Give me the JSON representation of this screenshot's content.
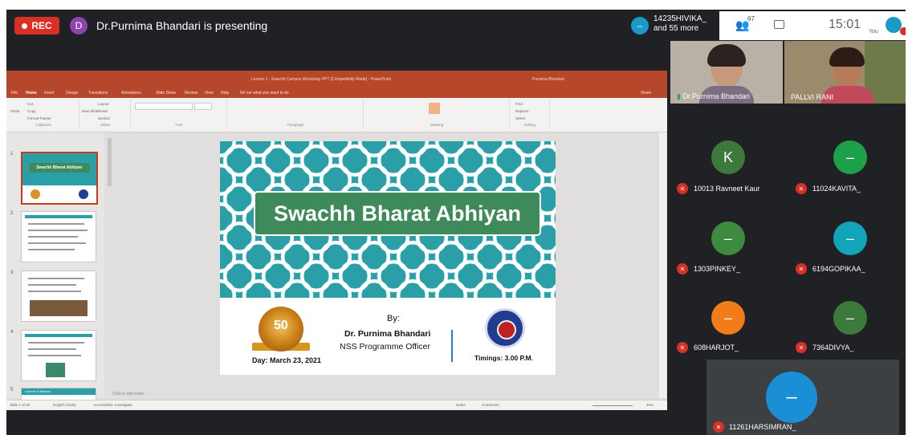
{
  "meet": {
    "rec_label": "REC",
    "presenter_initial": "D",
    "presenting_text": "Dr.Purnima Bhandari is presenting",
    "top_participant_line1": "14235HIVIKA_",
    "top_participant_line2": "and 55 more",
    "participant_count": "67",
    "time": "15:01",
    "you_label": "You"
  },
  "ppt": {
    "window_title": "Lesson 1 - Swachh Campus Workshop PPT [Compatibility Mode] - PowerPoint",
    "user_name": "Purnima Bhandari",
    "tabs": [
      "File",
      "Home",
      "Insert",
      "Design",
      "Transitions",
      "Animations",
      "Slide Show",
      "Review",
      "View",
      "Help",
      "Tell me what you want to do"
    ],
    "share_label": "Share",
    "ribbon_groups": [
      "Clipboard",
      "Slides",
      "Font",
      "Paragraph",
      "Drawing",
      "Editing"
    ],
    "clipboard_items": [
      "Cut",
      "Copy",
      "Format Painter",
      "Paste"
    ],
    "slides_items": [
      "Layout",
      "Reset",
      "Section",
      "New Slide"
    ],
    "editing_items": [
      "Find",
      "Replace",
      "Select"
    ],
    "slide_numbers": [
      "1",
      "2",
      "3",
      "4",
      "5"
    ],
    "thumb_titles": [
      "Swachh Bharat Abhiyan",
      "",
      "",
      "",
      "Launch of Mission"
    ],
    "notes_placeholder": "Click to add notes",
    "status_slide": "Slide 1 of 26",
    "status_lang": "English (India)",
    "status_access": "Accessibility: Investigate",
    "status_notes": "Notes",
    "status_comments": "Comments",
    "status_zoom": "46%"
  },
  "slide": {
    "title": "Swachh Bharat Abhiyan",
    "by": "By:",
    "presenter": "Dr. Purnima Bhandari",
    "role": "NSS Programme Officer",
    "day": "Day: March 23, 2021",
    "timings": "Timings: 3.00 P.M.",
    "badge_text": "50"
  },
  "participants": {
    "top_tiles": [
      {
        "name": "Dr.Purnima Bhandari"
      },
      {
        "name": "PALLVI RANI"
      }
    ],
    "grid": [
      {
        "initial": "K",
        "name": "10013 Ravneet Kaur",
        "color": "#3b7a3a"
      },
      {
        "initial": "–",
        "name": "11024KAVITA_",
        "color": "#1e9f4a"
      },
      {
        "initial": "–",
        "name": "1303PINKEY_",
        "color": "#3e8a3e"
      },
      {
        "initial": "–",
        "name": "6194GOPIKAA_",
        "color": "#12a4b8"
      },
      {
        "initial": "–",
        "name": "608HARJOT_",
        "color": "#f27b1a"
      },
      {
        "initial": "–",
        "name": "7364DIVYA_",
        "color": "#3b7a3a"
      }
    ],
    "self_tile": {
      "initial": "–",
      "name": "11261HARSIMRAN_",
      "color": "#1a8fd6"
    }
  },
  "colors": {
    "rec_red": "#d93025",
    "ppt_orange": "#b7472a",
    "slide_teal": "#2a9fa8",
    "slide_green": "#3e8a5a"
  }
}
